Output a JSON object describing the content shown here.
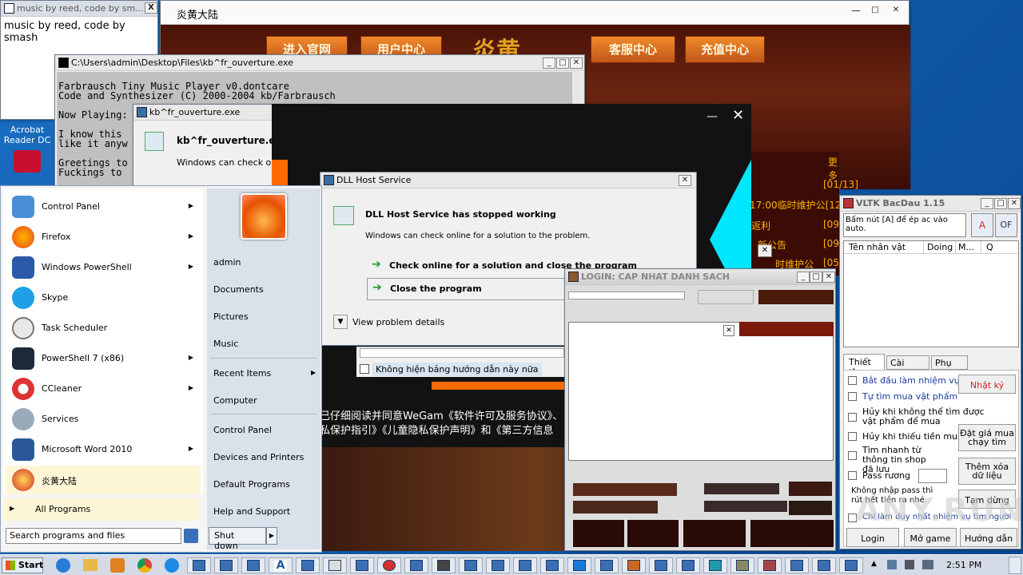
{
  "desktop_icon": {
    "label_1": "Acrobat",
    "label_2": "Reader DC"
  },
  "music_win": {
    "title": "music by reed, code by sm...",
    "text_1": "music by reed, code by",
    "text_2": "smash",
    "close": "X"
  },
  "game_main": {
    "title": "炎黄大陆",
    "nav": [
      "进入官网",
      "用户中心",
      "客服中心",
      "充值中心"
    ],
    "more": "更多",
    "date1": "[01/13]",
    "news": [
      {
        "text": "17:00临时维护公[12/",
        "y": "255"
      },
      {
        "text": "返利",
        "date": "[09"
      },
      {
        "text": "新公告",
        "date": "[09"
      },
      {
        "text": "时维护公",
        "date": "[05"
      }
    ]
  },
  "console": {
    "title": "C:\\Users\\admin\\Desktop\\Files\\kb^fr_ouverture.exe",
    "lines": [
      "Farbrausch Tiny Music Player v0.dontcare",
      "Code and Synthesizer (C) 2000-2004 kb/Farbrausch",
      "",
      "Now Playing:",
      "",
      "I know this",
      "like it anyw",
      "",
      "Greetings to",
      "Fuckings to"
    ]
  },
  "kbfr": {
    "title": "kb^fr_ouverture.exe",
    "heading": "kb^fr_ouverture.exe",
    "sub": "Windows can check onlin"
  },
  "dll": {
    "title": "DLL Host Service",
    "heading": "DLL Host Service has stopped working",
    "sub": "Windows can check online for a solution to the problem.",
    "opt1": "Check online for a solution and close the program",
    "opt2": "Close the program",
    "details": "View problem details"
  },
  "wegame": {
    "checkbox": "Không hiện bảng hướng dẫn này nữa",
    "line1": "已仔细阅读并同意WeGam《软件许可及服务协议》、",
    "line2": "私保护指引》《儿童隐私保护声明》和《第三方信息"
  },
  "login": {
    "title": "LOGIN: CAP NHAT DANH SACH"
  },
  "start_menu": {
    "items": [
      {
        "label": "Control Panel",
        "arrow": "▶"
      },
      {
        "label": "Firefox",
        "arrow": "▶"
      },
      {
        "label": "Windows PowerShell",
        "arrow": "▶"
      },
      {
        "label": "Skype",
        "arrow": ""
      },
      {
        "label": "Task Scheduler",
        "arrow": ""
      },
      {
        "label": "PowerShell 7 (x86)",
        "arrow": "▶"
      },
      {
        "label": "CCleaner",
        "arrow": "▶"
      },
      {
        "label": "Services",
        "arrow": ""
      },
      {
        "label": "Microsoft Word 2010",
        "arrow": "▶"
      },
      {
        "label": "炎黄大陆",
        "arrow": ""
      }
    ],
    "all_programs": "All Programs",
    "search_placeholder": "Search programs and files",
    "right": [
      "admin",
      "Documents",
      "Pictures",
      "Music",
      "Recent Items",
      "Computer",
      "Control Panel",
      "Devices and Printers",
      "Default Programs",
      "Help and Support"
    ],
    "shutdown": "Shut down"
  },
  "vltk": {
    "title": "VLTK BacDau 1.15",
    "hint": "Bấm nút [A] để ép ac vào auto.",
    "btn_a": "A",
    "btn_of": "OF",
    "cols": [
      "Tên nhân vật",
      "Doing",
      "M...",
      "Q"
    ],
    "tabs": [
      "Thiết lập",
      "Cài game",
      "Phụ trợ"
    ],
    "checks": [
      "Bắt đầu làm nhiệm vụ",
      "Tự tìm mua vật phẩm",
      "Hủy khi không thể tìm được vật phẩm để mua",
      "Hủy khi thiếu tiền mua",
      "Tìm nhanh từ thông tin shop đã lưu",
      "Pass rương"
    ],
    "note": "Không nhập pass thì rút hết tiền ra nhé",
    "last_check": "Chỉ làm duy nhất nhiệm vụ tìm người",
    "buttons": [
      "Nhật ký",
      "Đặt giá mua chạy tìm",
      "Thêm xóa dữ liệu",
      "Tạm dừng"
    ],
    "bottom": [
      "Login",
      "Mở game",
      "Hướng dẫn"
    ]
  },
  "taskbar": {
    "start": "Start",
    "time": "2:51 PM"
  },
  "watermark": "ANY.RUN"
}
